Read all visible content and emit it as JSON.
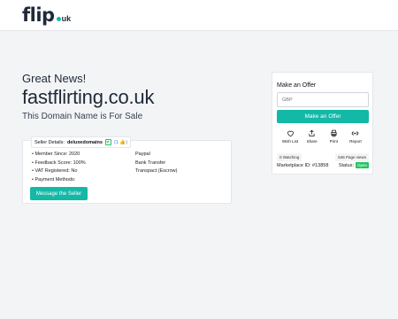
{
  "brand": {
    "logo_main": "flip",
    "logo_tld": "uk"
  },
  "hero": {
    "greeting": "Great News!",
    "domain": "fastflirting.co.uk",
    "subtitle": "This Domain Name is For Sale"
  },
  "seller": {
    "label": "Seller Details:",
    "name": "deluxedomains",
    "rating": "(1",
    "rating_close": ")",
    "details": [
      "Member Since: 2020",
      "Feedback Score: 100%",
      "VAT Registered: No",
      "Payment Methods:"
    ],
    "payment_methods": [
      "Paypal",
      "Bank Transfer",
      "Transpact (Escrow)"
    ],
    "message_button": "Message the Seller"
  },
  "offer": {
    "title": "Make an Offer",
    "input_placeholder": "GBP",
    "button": "Make an Offer",
    "actions": [
      {
        "label": "Wish List",
        "icon": "heart-icon"
      },
      {
        "label": "Share",
        "icon": "share-icon"
      },
      {
        "label": "Print",
        "icon": "printer-icon"
      },
      {
        "label": "Report",
        "icon": "link-icon"
      }
    ],
    "watching": "0 Watching",
    "page_views": "546 Page views",
    "marketplace_id": "Marketplace ID: #13858",
    "status_label": "Status:",
    "status_value": "Open"
  },
  "colors": {
    "accent": "#14b8a6",
    "status_open": "#22c55e",
    "background": "#f3f4f6"
  }
}
